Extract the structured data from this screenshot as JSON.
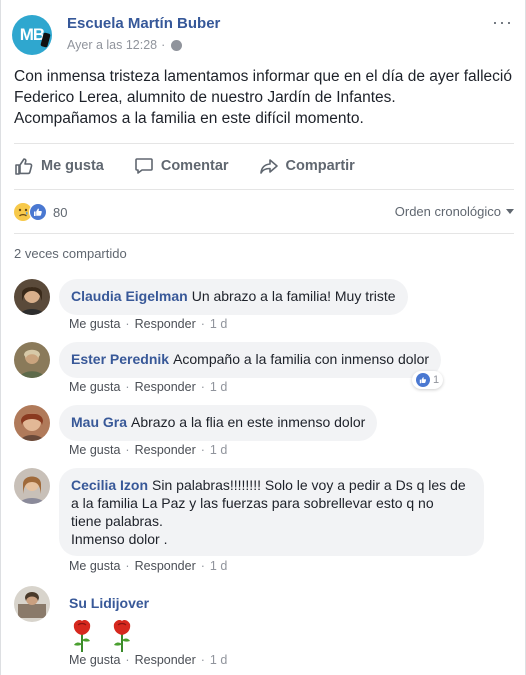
{
  "post": {
    "page_name": "Escuela Martín Buber",
    "avatar_text": "MB",
    "timestamp": "Ayer a las 12:28",
    "separator": "·",
    "more": "···",
    "text_lines": [
      "Con inmensa tristeza lamentamos informar que en el día de ayer falleció",
      "Federico Lerea, alumnito de nuestro Jardín de Infantes.",
      "Acompañamos a la familia en este difícil momento."
    ]
  },
  "actions": {
    "like": "Me gusta",
    "comment": "Comentar",
    "share": "Compartir"
  },
  "reactions": {
    "count": "80",
    "sort_label": "Orden cronológico",
    "shares_label": "2 veces compartido"
  },
  "comment_actions": {
    "like": "Me gusta",
    "reply": "Responder",
    "dot": "·"
  },
  "comments": [
    {
      "author": "Claudia Eigelman",
      "text": "Un abrazo a la familia! Muy triste",
      "time": "1 d"
    },
    {
      "author": "Ester Perednik",
      "text": "Acompaño a la familia con inmenso dolor",
      "time": "1 d",
      "likes": "1"
    },
    {
      "author": "Mau Gra",
      "text": "Abrazo a la flia en este inmenso dolor",
      "time": "1 d"
    },
    {
      "author": "Cecilia Izon",
      "text_lines": [
        "Sin palabras!!!!!!!! Solo le voy a pedir a Ds q les de",
        "a la familia La Paz y las fuerzas para sobrellevar esto q no",
        "tiene palabras.",
        "Inmenso dolor ."
      ],
      "time": "1 d"
    },
    {
      "author": "Su Lidijover",
      "time": "1 d"
    }
  ],
  "colors": {
    "link_blue": "#365899",
    "meta_gray": "#90949c",
    "bubble_bg": "#f2f3f5",
    "like_blue": "#4a78d1"
  }
}
